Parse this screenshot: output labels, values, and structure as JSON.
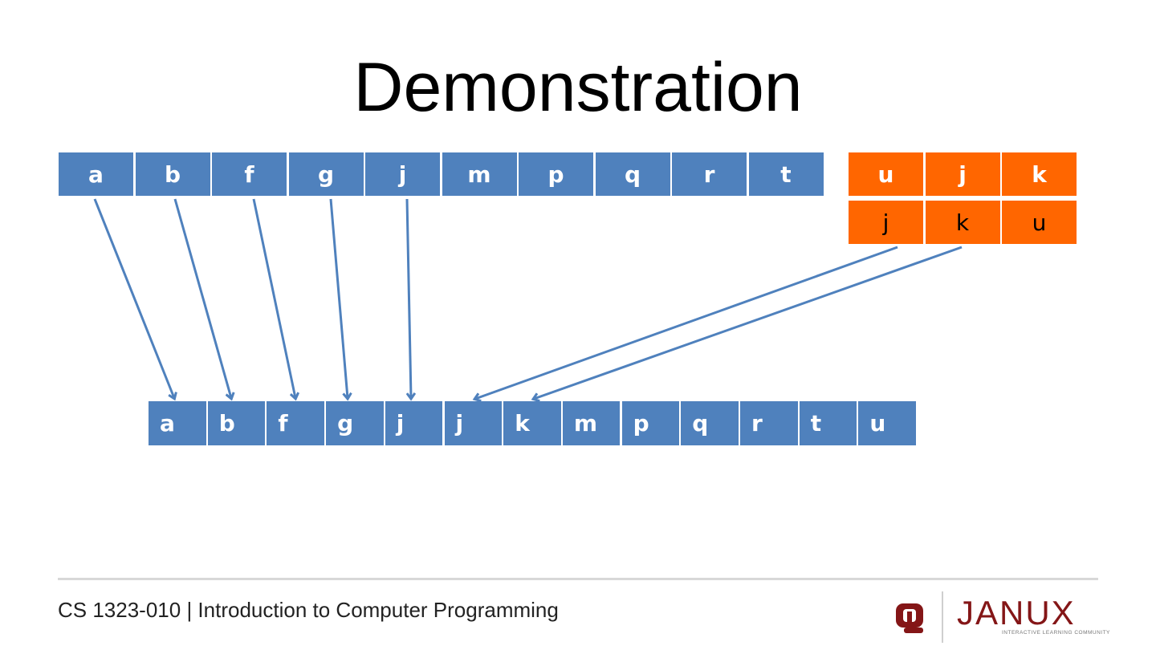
{
  "slide": {
    "title": "Demonstration",
    "footer": "CS 1323-010 | Introduction to Computer Programming"
  },
  "diagram": {
    "top_left_array": [
      "a",
      "b",
      "f",
      "g",
      "j",
      "m",
      "p",
      "q",
      "r",
      "t"
    ],
    "orange_original": [
      "u",
      "j",
      "k"
    ],
    "orange_sorted": [
      "j",
      "k",
      "u"
    ],
    "merged_array": [
      "a",
      "b",
      "f",
      "g",
      "j",
      "j",
      "k",
      "m",
      "p",
      "q",
      "r",
      "t",
      "u"
    ],
    "colors": {
      "blue": "#4f81bd",
      "orange": "#ff6600",
      "arrow": "#4f81bd"
    }
  },
  "logo": {
    "brand": "JANUX",
    "tagline": "INTERACTIVE LEARNING COMMUNITY",
    "icon": "ou-logo-icon"
  }
}
